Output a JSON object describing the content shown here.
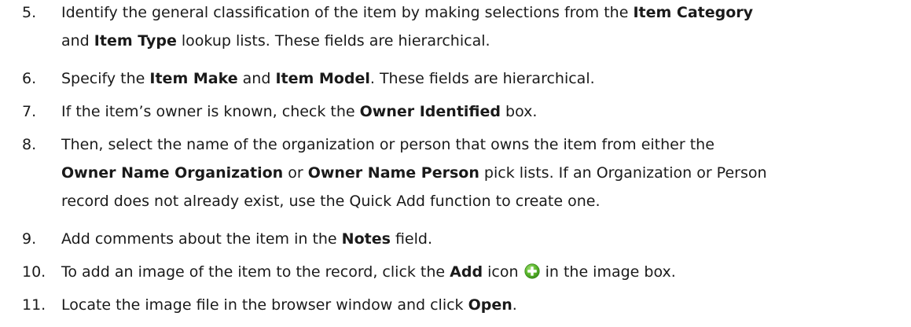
{
  "steps": [
    {
      "number": "5.",
      "line1": {
        "t1": "Identify the general classification of the item by making selections from the ",
        "b1": "Item Category"
      },
      "line2": {
        "t1": "and ",
        "b1": "Item Type",
        "t2": " lookup lists. These fields are hierarchical."
      }
    },
    {
      "number": "6.",
      "t1": "Specify the ",
      "b1": "Item Make",
      "t2": " and ",
      "b2": "Item Model",
      "t3": ". These fields are hierarchical."
    },
    {
      "number": "7.",
      "t1": "If the item’s owner is known, check the ",
      "b1": "Owner Identified",
      "t2": " box."
    },
    {
      "number": "8.",
      "line1": {
        "t1": "Then, select the name of the organization or person that owns the item from either the"
      },
      "line2": {
        "b1": "Owner Name Organization",
        "t1": " or ",
        "b2": "Owner Name Person",
        "t2": " pick lists. If an Organization or Person"
      },
      "line3": {
        "t1": "record does not already exist, use the Quick Add function to create one."
      }
    },
    {
      "number": "9.",
      "t1": "Add comments about the item in the ",
      "b1": "Notes",
      "t2": " field."
    },
    {
      "number": "10.",
      "t1": "To add an image of the item to the record, click the ",
      "b1": "Add",
      "t2": " icon ",
      "icon": "add-plus-icon",
      "t3": " in the image box."
    },
    {
      "number": "11.",
      "t1": "Locate the image file in the browser window and click ",
      "b1": "Open",
      "t2": "."
    }
  ],
  "colors": {
    "add_icon_green": "#5cb82e"
  }
}
